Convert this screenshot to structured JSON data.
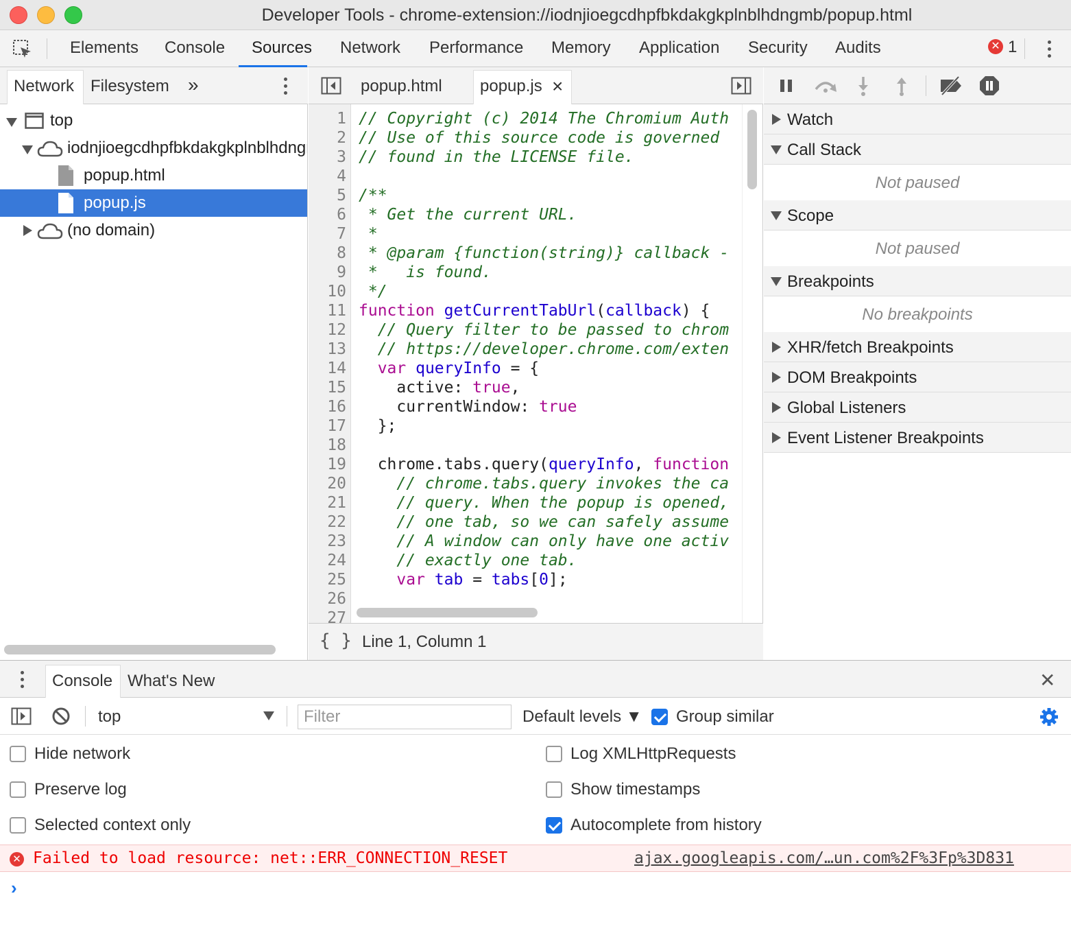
{
  "window": {
    "title": "Developer Tools - chrome-extension://iodnjioegcdhpfbkdakgkplnblhdngmb/popup.html"
  },
  "main_tabs": [
    "Elements",
    "Console",
    "Sources",
    "Network",
    "Performance",
    "Memory",
    "Application",
    "Security",
    "Audits"
  ],
  "active_main_tab": "Sources",
  "error_count": "1",
  "navigator": {
    "tabs": [
      "Network",
      "Filesystem"
    ],
    "more": "»",
    "tree": {
      "top": "top",
      "domain": "iodnjioegcdhpfbkdakgkplnblhdngmb",
      "file1": "popup.html",
      "file2": "popup.js",
      "no_domain": "(no domain)"
    }
  },
  "editor": {
    "tabs": [
      "popup.html",
      "popup.js"
    ],
    "close_glyph": "×",
    "status": "Line 1, Column 1",
    "format_glyph": "{ }",
    "line_numbers": [
      "1",
      "2",
      "3",
      "4",
      "5",
      "6",
      "7",
      "8",
      "9",
      "10",
      "11",
      "12",
      "13",
      "14",
      "15",
      "16",
      "17",
      "18",
      "19",
      "20",
      "21",
      "22",
      "23",
      "24",
      "25",
      "26",
      "27"
    ],
    "lines": [
      [
        [
          "c",
          "// Copyright (c) 2014 The Chromium Auth"
        ]
      ],
      [
        [
          "c",
          "// Use of this source code is governed"
        ]
      ],
      [
        [
          "c",
          "// found in the LICENSE file."
        ]
      ],
      [],
      [
        [
          "c",
          "/**"
        ]
      ],
      [
        [
          "c",
          " * Get the current URL."
        ]
      ],
      [
        [
          "c",
          " *"
        ]
      ],
      [
        [
          "c",
          " * @param {function(string)} callback -"
        ]
      ],
      [
        [
          "c",
          " *   is found."
        ]
      ],
      [
        [
          "c",
          " */"
        ]
      ],
      [
        [
          "k",
          "function"
        ],
        [
          "t",
          " "
        ],
        [
          "v",
          "getCurrentTabUrl"
        ],
        [
          "t",
          "("
        ],
        [
          "v",
          "callback"
        ],
        [
          "t",
          ") {"
        ]
      ],
      [
        [
          "t",
          "  "
        ],
        [
          "c",
          "// Query filter to be passed to chrom"
        ]
      ],
      [
        [
          "t",
          "  "
        ],
        [
          "c",
          "// https://developer.chrome.com/exten"
        ]
      ],
      [
        [
          "t",
          "  "
        ],
        [
          "k",
          "var"
        ],
        [
          "t",
          " "
        ],
        [
          "v",
          "queryInfo"
        ],
        [
          "t",
          " = {"
        ]
      ],
      [
        [
          "t",
          "    active: "
        ],
        [
          "k",
          "true"
        ],
        [
          "t",
          ","
        ]
      ],
      [
        [
          "t",
          "    currentWindow: "
        ],
        [
          "k",
          "true"
        ]
      ],
      [
        [
          "t",
          "  };"
        ]
      ],
      [],
      [
        [
          "t",
          "  chrome.tabs.query("
        ],
        [
          "v",
          "queryInfo"
        ],
        [
          "t",
          ", "
        ],
        [
          "k",
          "function"
        ]
      ],
      [
        [
          "t",
          "    "
        ],
        [
          "c",
          "// chrome.tabs.query invokes the ca"
        ]
      ],
      [
        [
          "t",
          "    "
        ],
        [
          "c",
          "// query. When the popup is opened,"
        ]
      ],
      [
        [
          "t",
          "    "
        ],
        [
          "c",
          "// one tab, so we can safely assume"
        ]
      ],
      [
        [
          "t",
          "    "
        ],
        [
          "c",
          "// A window can only have one activ"
        ]
      ],
      [
        [
          "t",
          "    "
        ],
        [
          "c",
          "// exactly one tab."
        ]
      ],
      [
        [
          "t",
          "    "
        ],
        [
          "k",
          "var"
        ],
        [
          "t",
          " "
        ],
        [
          "v",
          "tab"
        ],
        [
          "t",
          " = "
        ],
        [
          "v",
          "tabs"
        ],
        [
          "t",
          "["
        ],
        [
          "v",
          "0"
        ],
        [
          "t",
          "];"
        ]
      ],
      [],
      []
    ]
  },
  "debugger": {
    "sections": {
      "watch": "Watch",
      "call_stack": "Call Stack",
      "call_stack_empty": "Not paused",
      "scope": "Scope",
      "scope_empty": "Not paused",
      "breakpoints": "Breakpoints",
      "breakpoints_empty": "No breakpoints",
      "xhr": "XHR/fetch Breakpoints",
      "dom": "DOM Breakpoints",
      "global": "Global Listeners",
      "event": "Event Listener Breakpoints"
    }
  },
  "drawer": {
    "tabs": [
      "Console",
      "What's New"
    ],
    "close_glyph": "✕",
    "context": "top",
    "filter_placeholder": "Filter",
    "levels": "Default levels ▼",
    "group_similar": "Group similar",
    "options": {
      "hide_network": "Hide network",
      "preserve_log": "Preserve log",
      "selected_context_only": "Selected context only",
      "log_xhr": "Log XMLHttpRequests",
      "show_timestamps": "Show timestamps",
      "autocomplete": "Autocomplete from history"
    },
    "error": {
      "message": "Failed to load resource: net::ERR_CONNECTION_RESET",
      "source": "ajax.googleapis.com/…un.com%2F%3Fp%3D831"
    },
    "prompt": "›"
  },
  "colors": {
    "accent": "#1a73e8",
    "selection": "#3879d9",
    "error": "#e53935"
  }
}
